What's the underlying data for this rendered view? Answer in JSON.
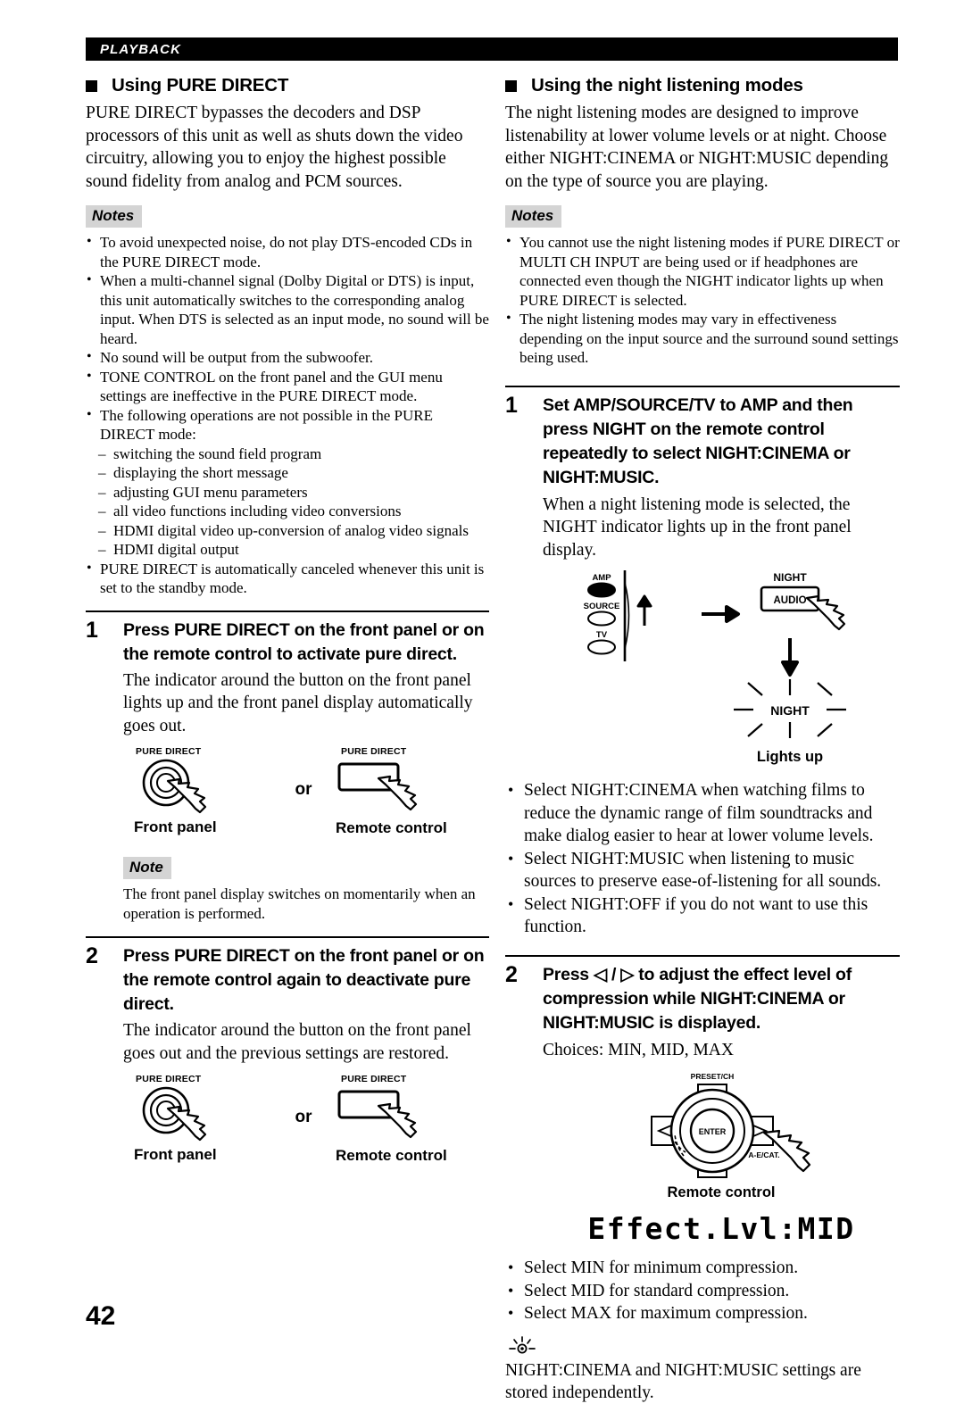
{
  "header": {
    "running_label": "PLAYBACK"
  },
  "page_number": "42",
  "left": {
    "heading": "Using PURE DIRECT",
    "intro": "PURE DIRECT bypasses the decoders and DSP processors of this unit as well as shuts down the video circuitry, allowing you to enjoy the highest possible sound fidelity from analog and PCM sources.",
    "notes_tag": "Notes",
    "notes": [
      "To avoid unexpected noise, do not play DTS-encoded CDs in the PURE DIRECT mode.",
      "When a multi-channel signal (Dolby Digital or DTS) is input, this unit automatically switches to the corresponding analog input. When DTS is selected as an input mode, no sound will be heard.",
      "No sound will be output from the subwoofer.",
      "TONE CONTROL on the front panel and the GUI menu settings are ineffective in the PURE DIRECT mode.",
      "The following operations are not possible in the PURE DIRECT mode:"
    ],
    "sub_items": [
      "switching the sound field program",
      "displaying the short message",
      "adjusting GUI menu parameters",
      "all video functions including video conversions",
      "HDMI digital video up-conversion of analog video signals",
      "HDMI digital output"
    ],
    "notes_last": "PURE DIRECT is automatically canceled whenever this unit is set to the standby mode.",
    "step1": {
      "number": "1",
      "title": "Press PURE DIRECT on the front panel or on the remote control to activate pure direct.",
      "body": "The indicator around the button on the front panel lights up and the front panel display automatically goes out."
    },
    "figure1": {
      "front_button_label": "PURE DIRECT",
      "remote_button_label": "PURE DIRECT",
      "or": "or",
      "front_caption": "Front panel",
      "remote_caption": "Remote control"
    },
    "note_tag": "Note",
    "note_text": "The front panel display switches on momentarily when an operation is performed.",
    "step2": {
      "number": "2",
      "title": "Press PURE DIRECT on the front panel or on the remote control again to deactivate pure direct.",
      "body": "The indicator around the button on the front panel goes out and the previous settings are restored."
    },
    "figure2": {
      "front_button_label": "PURE DIRECT",
      "remote_button_label": "PURE DIRECT",
      "or": "or",
      "front_caption": "Front panel",
      "remote_caption": "Remote control"
    }
  },
  "right": {
    "heading": "Using the night listening modes",
    "intro": "The night listening modes are designed to improve listenability at lower volume levels or at night. Choose either NIGHT:CINEMA or NIGHT:MUSIC depending on the type of source you are playing.",
    "notes_tag": "Notes",
    "notes": [
      "You cannot use the night listening modes if PURE DIRECT or MULTI CH INPUT are being used or if headphones are connected even though the NIGHT indicator lights up when PURE DIRECT is selected.",
      "The night listening modes may vary in effectiveness depending on the input source and the surround sound settings being used."
    ],
    "step1": {
      "number": "1",
      "title": "Set AMP/SOURCE/TV to AMP and then press NIGHT on the remote control repeatedly to select NIGHT:CINEMA or NIGHT:MUSIC.",
      "body": "When a night listening mode is selected, the NIGHT indicator lights up in the front panel display."
    },
    "figure1": {
      "switch_amp": "AMP",
      "switch_source": "SOURCE",
      "switch_tv": "TV",
      "night_label": "NIGHT",
      "audio_button": "AUDIO",
      "indicator_label": "NIGHT",
      "lights_up_caption": "Lights up"
    },
    "bullets": [
      "Select NIGHT:CINEMA when watching films to reduce the dynamic range of film soundtracks and make dialog easier to hear at lower volume levels.",
      "Select NIGHT:MUSIC when listening to music sources to preserve ease-of-listening for all sounds.",
      "Select NIGHT:OFF if you do not want to use this function."
    ],
    "step2": {
      "number": "2",
      "title_pre": "Press ",
      "title_left_arrow": "◁",
      "title_slash": " / ",
      "title_right_arrow": "▷",
      "title_post": " to adjust the effect level of compression while NIGHT:CINEMA or NIGHT:MUSIC is displayed.",
      "choices": "Choices: MIN, MID, MAX"
    },
    "figure2": {
      "preset_label": "PRESET/CH",
      "enter_label": "ENTER",
      "aecat_label": "A-E/CAT.",
      "caption": "Remote control"
    },
    "display_readout": "Effect.Lvl:MID",
    "level_bullets": [
      "Select MIN for minimum compression.",
      "Select MID for standard compression.",
      "Select MAX for maximum compression."
    ],
    "tip_text": "NIGHT:CINEMA and NIGHT:MUSIC settings are stored independently."
  }
}
